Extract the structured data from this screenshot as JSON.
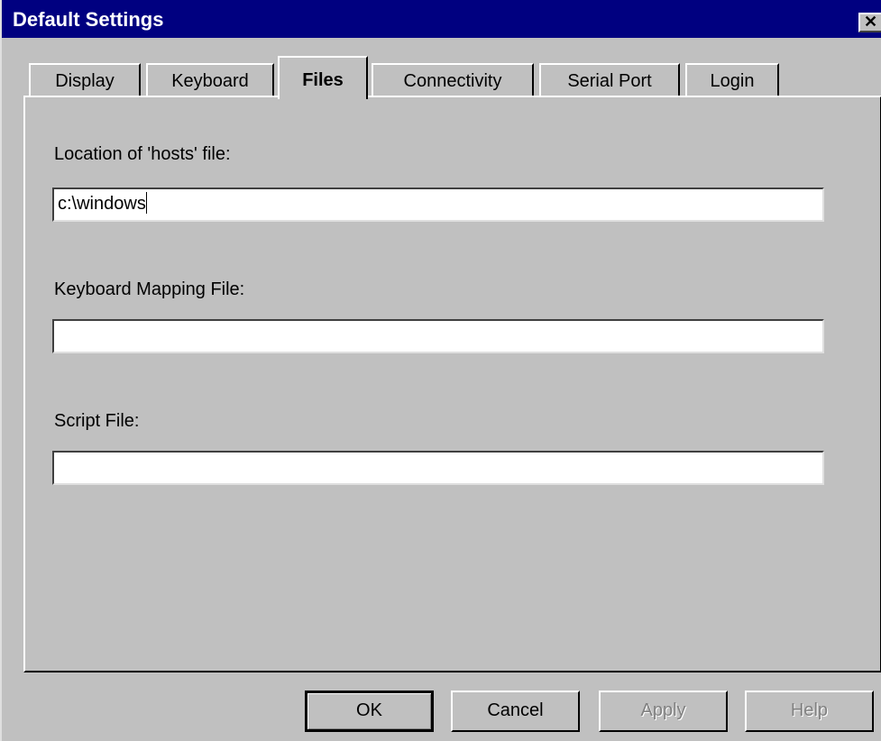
{
  "window": {
    "title": "Default Settings",
    "close_glyph": "✕"
  },
  "tabs": [
    {
      "label": "Display",
      "active": false
    },
    {
      "label": "Keyboard",
      "active": false
    },
    {
      "label": "Files",
      "active": true
    },
    {
      "label": "Connectivity",
      "active": false
    },
    {
      "label": "Serial Port",
      "active": false
    },
    {
      "label": "Login",
      "active": false
    }
  ],
  "files": {
    "hosts_label": "Location of 'hosts' file:",
    "hosts_value": "c:\\windows",
    "keymap_label": "Keyboard Mapping File:",
    "keymap_value": "",
    "script_label": "Script File:",
    "script_value": ""
  },
  "buttons": {
    "ok": "OK",
    "cancel": "Cancel",
    "apply": "Apply",
    "help": "Help"
  },
  "colors": {
    "titlebar": "#000080",
    "face": "#c0c0c0",
    "disabled_text": "#808080"
  }
}
